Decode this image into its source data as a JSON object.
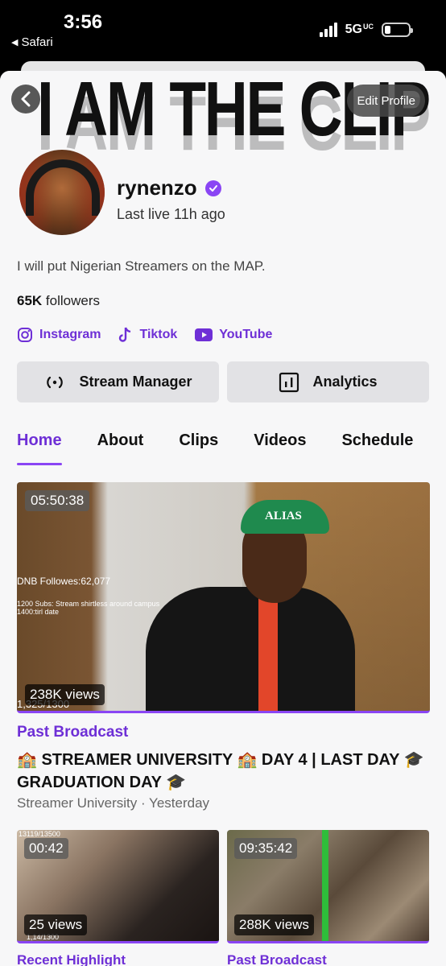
{
  "status": {
    "time": "3:56",
    "back_label": "Safari",
    "network": "5G",
    "network_suffix": "UC"
  },
  "banner": {
    "text": "I AM THE CLIP"
  },
  "header": {
    "edit_label": "Edit Profile"
  },
  "profile": {
    "username": "rynenzo",
    "last_live": "Last live 11h ago",
    "bio": "I will put Nigerian Streamers on the MAP.",
    "followers_count": "65K",
    "followers_label": "followers"
  },
  "socials": [
    {
      "label": "Instagram",
      "icon": "instagram-icon"
    },
    {
      "label": "Tiktok",
      "icon": "tiktok-icon"
    },
    {
      "label": "YouTube",
      "icon": "youtube-icon"
    }
  ],
  "actions": {
    "stream_manager": "Stream Manager",
    "analytics": "Analytics"
  },
  "tabs": [
    "Home",
    "About",
    "Clips",
    "Videos",
    "Schedule"
  ],
  "featured": {
    "duration": "05:50:38",
    "views": "238K views",
    "overlay_followers": "DNB Followes:62,077",
    "overlay_subs": "1200 Subs: Stream shirtless around campus",
    "overlay_subs2": "1400:tirl date",
    "overlay_count": "1,325/1300",
    "cap_text": "ALIAS",
    "type": "Past Broadcast",
    "title": "🏫 STREAMER UNIVERSITY 🏫 DAY 4 | LAST DAY 🎓GRADUATION DAY 🎓",
    "meta": "Streamer University · Yesterday"
  },
  "cards": [
    {
      "duration": "00:42",
      "views": "25 views",
      "type": "Recent Highlight",
      "overlay_top": "13119/13500",
      "overlay_bottom": "1,14/1300"
    },
    {
      "duration": "09:35:42",
      "views": "288K views",
      "type": "Past Broadcast"
    }
  ],
  "colors": {
    "accent": "#8a45f4",
    "accent_text": "#6e2fd6",
    "background": "#f7f7f8",
    "button": "#e2e2e5"
  }
}
